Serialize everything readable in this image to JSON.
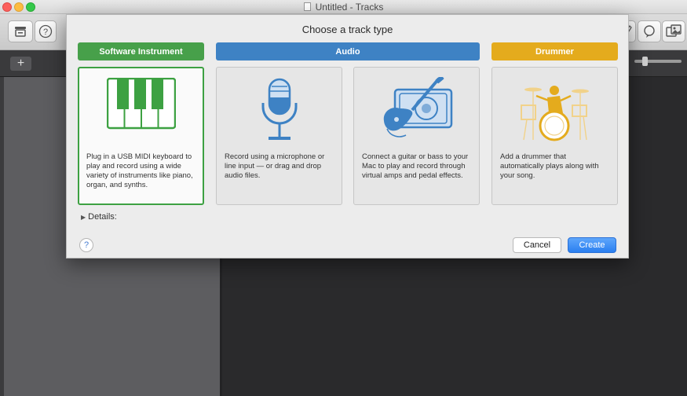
{
  "window": {
    "title": "Untitled - Tracks"
  },
  "toolbar": {
    "add_track": "+",
    "help": "?"
  },
  "dialog": {
    "title": "Choose a track type",
    "categories": {
      "software_instrument": "Software Instrument",
      "audio": "Audio",
      "drummer": "Drummer"
    },
    "cards": {
      "software_instrument": "Plug in a USB MIDI keyboard to play and record using a wide variety of instruments like piano, organ, and synths.",
      "microphone": "Record using a microphone or line input — or drag and drop audio files.",
      "guitar": "Connect a guitar or bass to your Mac to play and record through virtual amps and pedal effects.",
      "drummer": "Add a drummer that automatically plays along with your song."
    },
    "details_label": "Details:",
    "help": "?",
    "cancel_label": "Cancel",
    "create_label": "Create"
  },
  "colors": {
    "software_instrument": "#47a04a",
    "audio": "#3e82c4",
    "drummer": "#e4ab1d",
    "create_button": "#2a7ff0"
  },
  "icons": {
    "software_instrument": "piano-keys-icon",
    "microphone": "microphone-icon",
    "guitar": "guitar-amp-icon",
    "drummer": "drummer-kit-icon"
  }
}
